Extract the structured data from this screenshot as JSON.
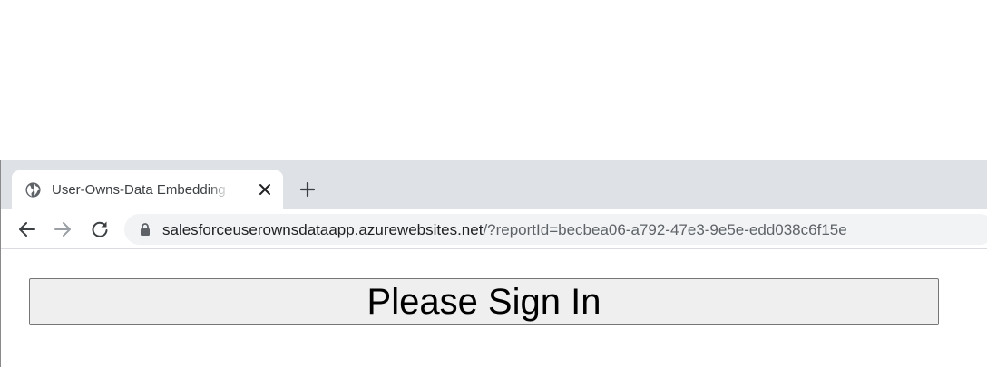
{
  "tab": {
    "title": "User-Owns-Data Embedding App",
    "favicon": "globe-icon",
    "close_icon": "close-icon"
  },
  "new_tab_icon": "plus-icon",
  "toolbar": {
    "back_icon": "arrow-left-icon",
    "forward_icon": "arrow-right-icon",
    "reload_icon": "reload-icon",
    "lock_icon": "lock-icon"
  },
  "address_bar": {
    "host": "salesforceuserownsdataapp.azurewebsites.net",
    "path": "/?reportId=becbea06-a792-47e3-9e5e-edd038c6f15e"
  },
  "page": {
    "sign_in_label": "Please Sign In"
  },
  "colors": {
    "tab_strip": "#dee1e6",
    "omnibox": "#f1f3f4",
    "button_bg": "#efefef"
  }
}
